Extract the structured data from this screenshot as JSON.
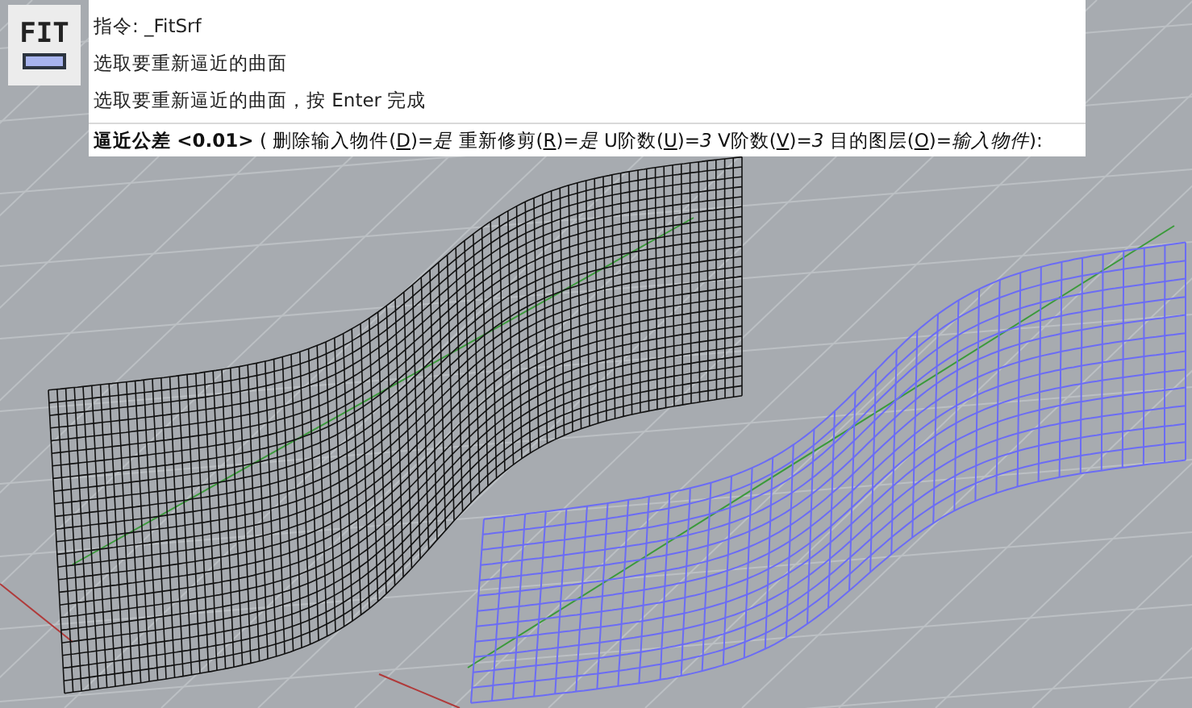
{
  "command_icon": {
    "label": "FIT"
  },
  "history": [
    "指令: _FitSrf",
    "选取要重新逼近的曲面",
    "选取要重新逼近的曲面，按 Enter 完成"
  ],
  "prompt": {
    "label": "逼近公差",
    "default": "<0.01>",
    "open": "(",
    "close": "):",
    "options": [
      {
        "before": "删除输入物件(",
        "key": "D",
        "after": ")=",
        "value": "是"
      },
      {
        "before": "重新修剪(",
        "key": "R",
        "after": ")=",
        "value": "是"
      },
      {
        "before": "U阶数(",
        "key": "U",
        "after": ")=",
        "value": "3"
      },
      {
        "before": "V阶数(",
        "key": "V",
        "after": ")=",
        "value": "3"
      },
      {
        "before": "目的图层(",
        "key": "O",
        "after": ")=",
        "value": "输入物件"
      }
    ]
  }
}
